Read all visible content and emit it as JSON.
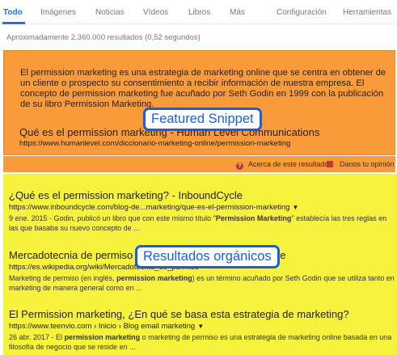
{
  "tabs": [
    "Todo",
    "Imágenes",
    "Noticias",
    "Vídeos",
    "Libros",
    "Más",
    "Configuración",
    "Herramientas"
  ],
  "stats": "Aproximadamente 2.360.000 resultados (0,52 segundos)",
  "featured": {
    "text": "El permission marketing es una estrategia de marketing online que se centra en obtener de un cliente o prospecto su consentimiento a recibir información de nuestra empresa. El concepto de permission marketing fue acuñado por Seth Godin en 1999 con la publicación de su libro Permission Marketing.",
    "title": "Qué es el permission marketing - Human Level Communications",
    "url": "https://www.humanlevel.com/diccionario-marketing-online/permission-marketing",
    "about_label": "Acerca de este resultado",
    "feedback_label": "Danos tu opinión"
  },
  "results": [
    {
      "title": "¿Qué es el permission marketing? - InboundCycle",
      "url": "https://www.inboundcycle.com/blog-de...marketing/que-es-el-permission-marketing",
      "date": "9 ene. 2015",
      "snippet_before": " - Godin, publicó un libro que con este mismo título \"",
      "snippet_bold": "Permission Marketing",
      "snippet_after": "\" establecía las tres reglas en las que basaba su nuevo concepto de ..."
    },
    {
      "title": "Mercadotecnia de permiso - Wikipedia, la enciclopedia libre",
      "url": "https://es.wikipedia.org/wiki/Mercadotecnia_de_permiso",
      "snippet_before": "Marketing de permiso (en inglés, ",
      "snippet_bold": "permission marketing",
      "snippet_after": ") es un término acuñado por Seth Godin que se utiliza tanto en marketing de manera general como en ..."
    },
    {
      "title": "El Permission marketing, ¿En qué se basa esta estrategia de marketing?",
      "url": "https://www.teenvio.com › Inicio › Blog email marketing",
      "date": "26 abr. 2017",
      "snippet_before": " - El ",
      "snippet_bold": "permission marketing",
      "snippet_after": " o marketing de permiso es una estrategia de marketing online basada en una filosofía de negocio que se reside en ..."
    }
  ],
  "callouts": {
    "featured": "Featured Snippet",
    "organic": "Resultados orgánicos"
  },
  "colors": {
    "featured_bg": "#f99b3b",
    "organic_bg": "#f7f23e",
    "callout_border": "#1a5ee0",
    "active_tab": "#1a73e8"
  }
}
